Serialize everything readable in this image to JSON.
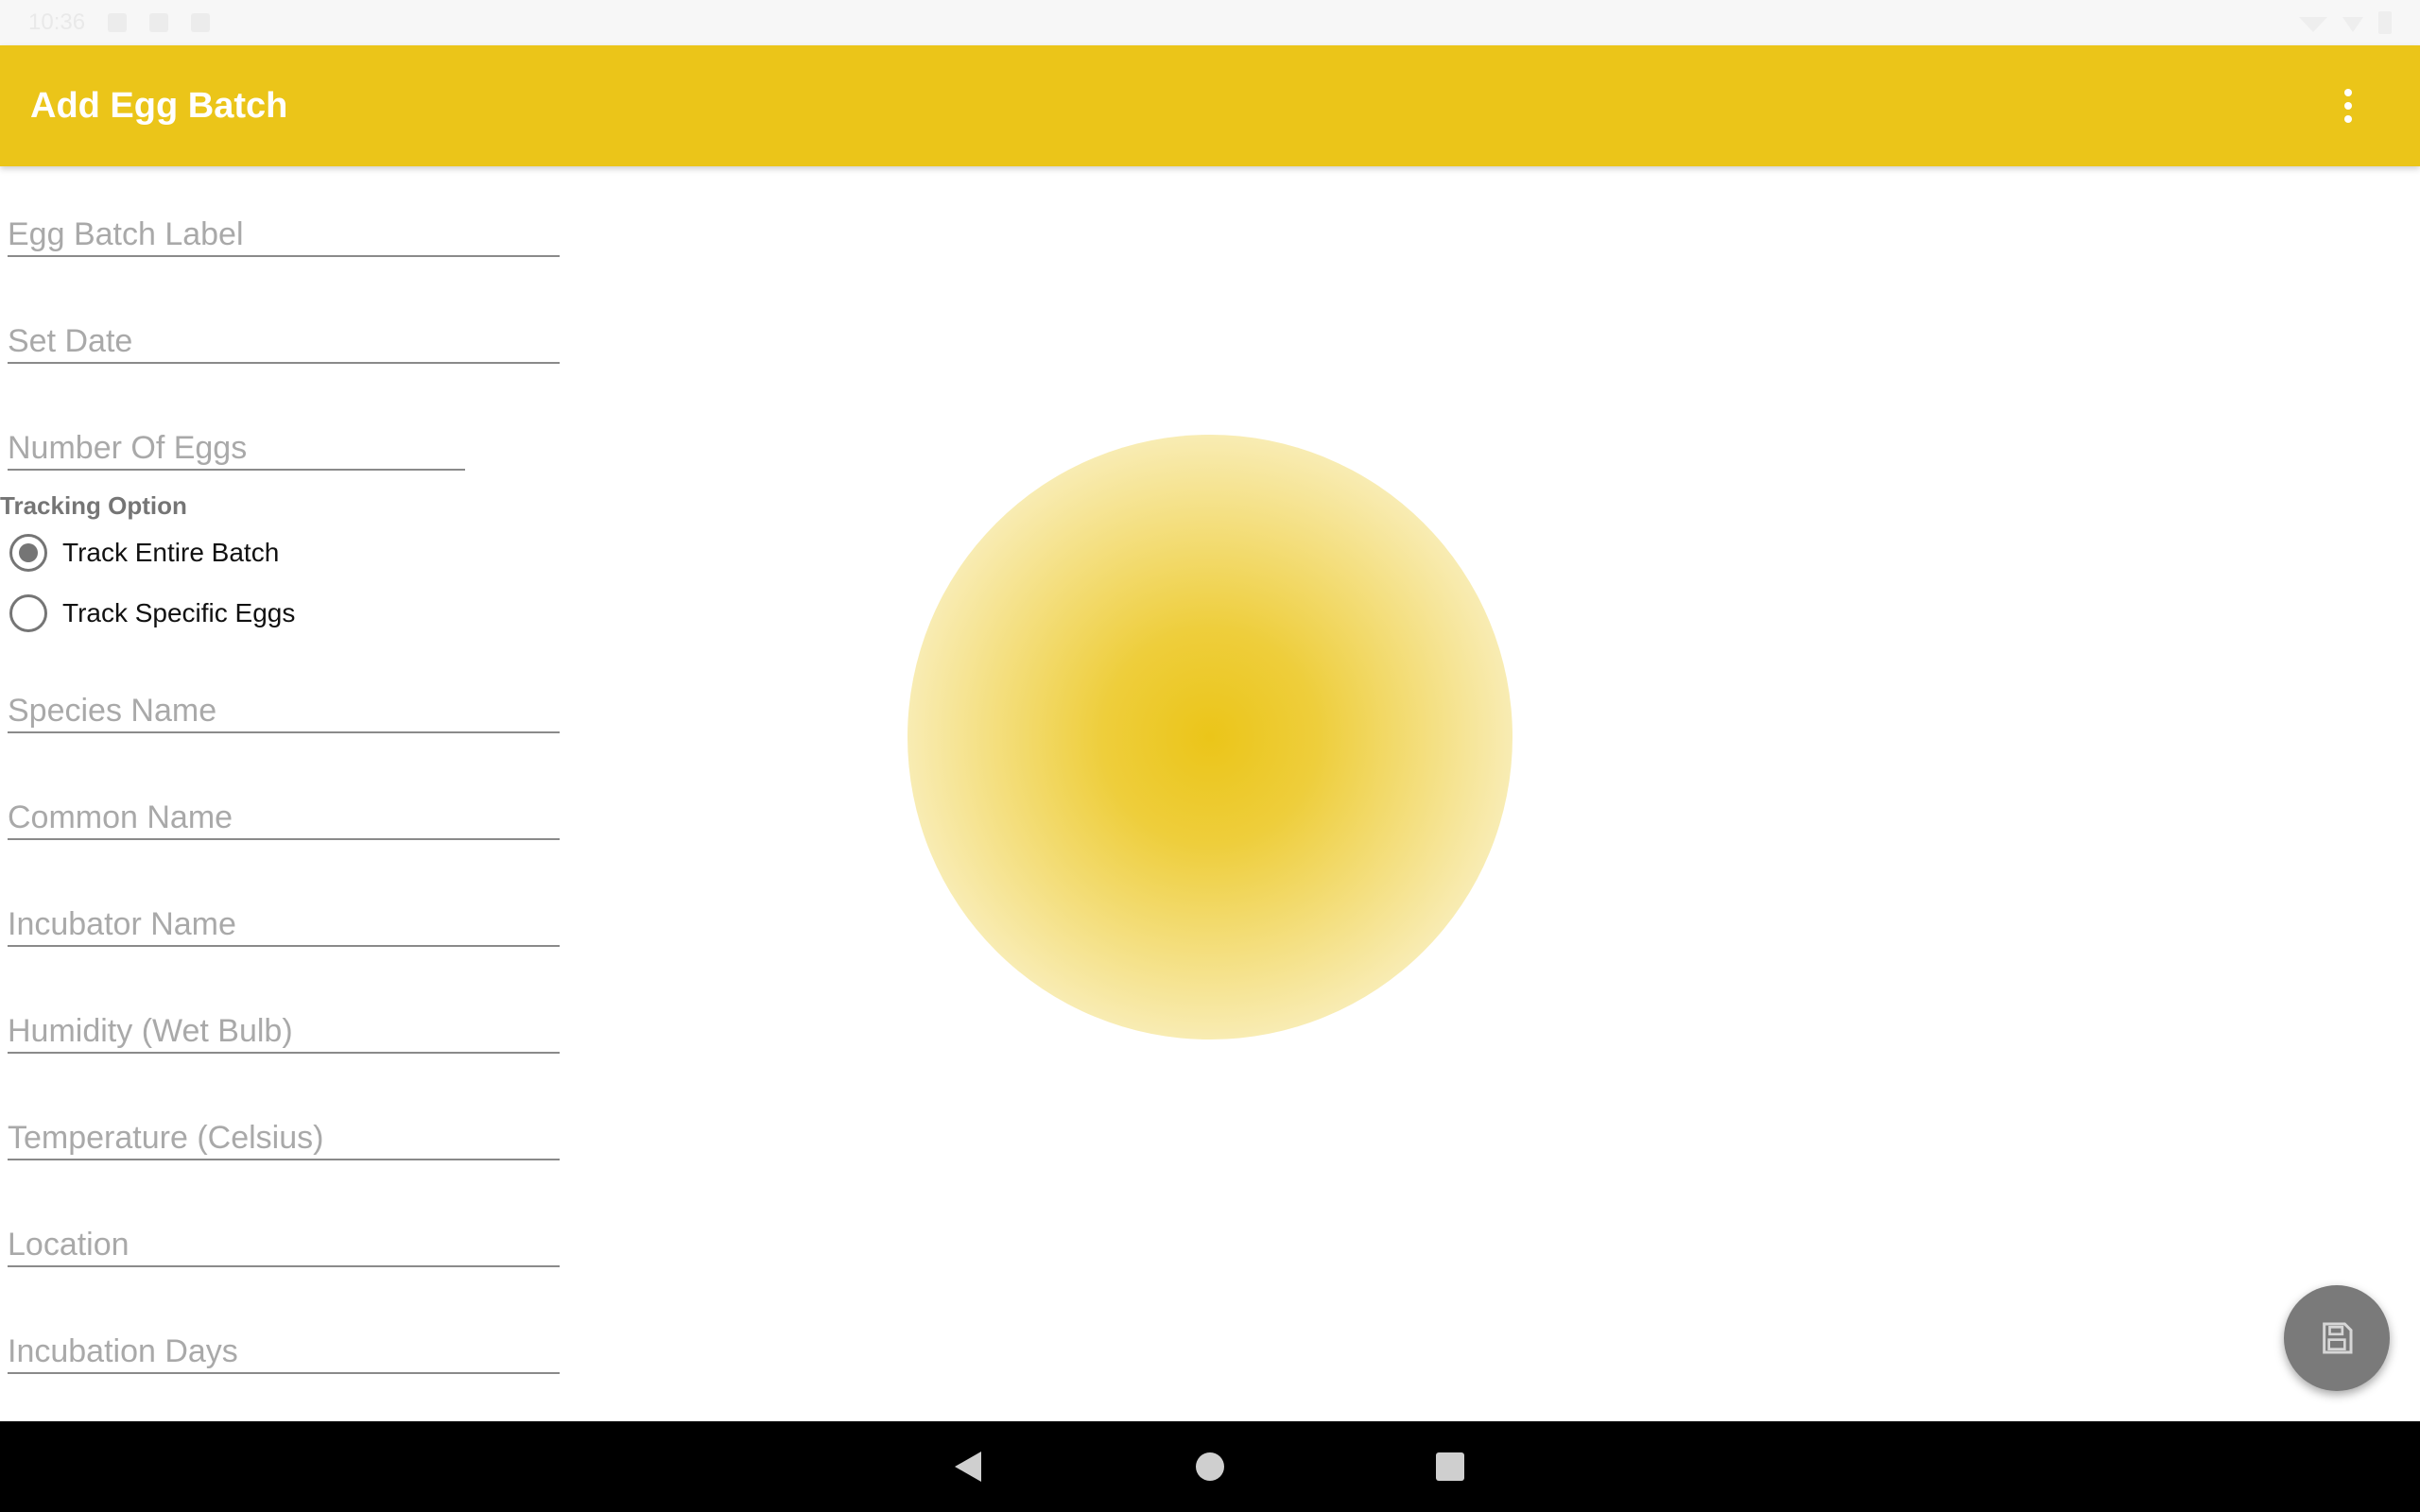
{
  "status_bar": {
    "time": "10:36"
  },
  "app_bar": {
    "title": "Add Egg Batch",
    "background_color": "#EBC519",
    "overflow_icon": "more-vert-icon"
  },
  "form": {
    "fields": {
      "egg_batch_label": {
        "placeholder": "Egg Batch Label",
        "value": ""
      },
      "set_date": {
        "placeholder": "Set Date",
        "value": ""
      },
      "number_of_eggs": {
        "placeholder": "Number Of Eggs",
        "value": ""
      },
      "species_name": {
        "placeholder": "Species Name",
        "value": ""
      },
      "common_name": {
        "placeholder": "Common Name",
        "value": ""
      },
      "incubator_name": {
        "placeholder": "Incubator Name",
        "value": ""
      },
      "humidity": {
        "placeholder": "Humidity (Wet Bulb)",
        "value": ""
      },
      "temperature": {
        "placeholder": "Temperature (Celsius)",
        "value": ""
      },
      "location": {
        "placeholder": "Location",
        "value": ""
      },
      "incubation_days": {
        "placeholder": "Incubation Days",
        "value": ""
      }
    },
    "tracking": {
      "label": "Tracking Option",
      "options": [
        {
          "label": "Track Entire Batch",
          "selected": true
        },
        {
          "label": "Track Specific Eggs",
          "selected": false
        }
      ]
    }
  },
  "fab": {
    "icon": "save-icon",
    "color": "#7a7a7a"
  },
  "nav_bar": {
    "back_icon": "back-triangle-icon",
    "home_icon": "home-circle-icon",
    "recents_icon": "recents-square-icon"
  }
}
